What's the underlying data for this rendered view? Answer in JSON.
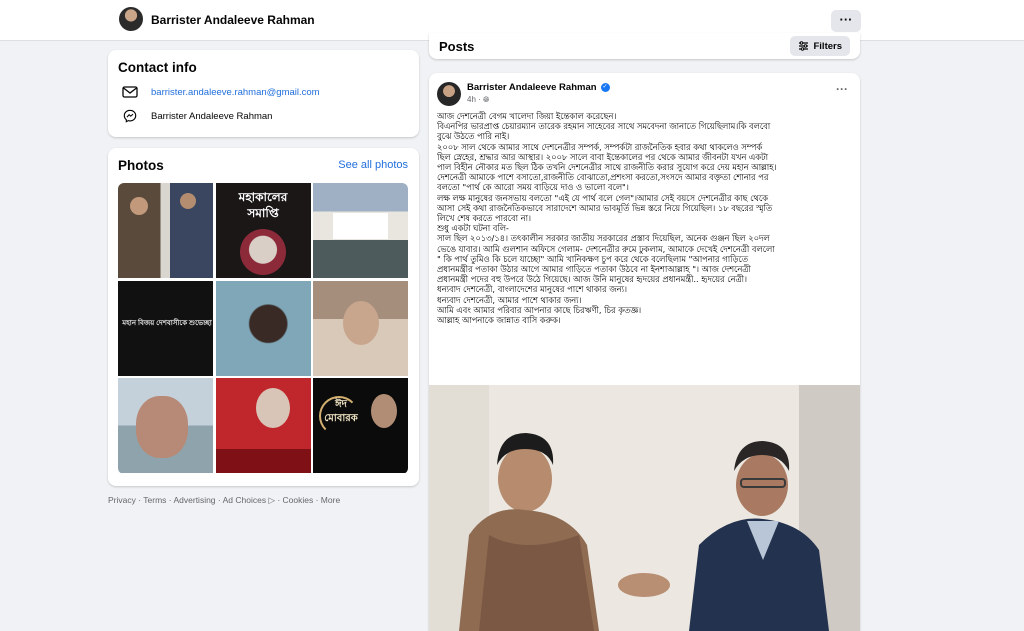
{
  "topbar": {
    "profile_name": "Barrister Andaleeve Rahman",
    "more_label": "···"
  },
  "contact": {
    "title": "Contact info",
    "email": "barrister.andaleeve.rahman@gmail.com",
    "messenger": "Barrister Andaleeve Rahman"
  },
  "photos": {
    "title": "Photos",
    "see_all": "See all photos",
    "captions": {
      "tile2": "মহাকালের সমাপ্তি",
      "tile4": "মহান বিজয় দেশবাসীকে শুভেচ্ছা",
      "tile9": "ঈদ মোবারক"
    }
  },
  "footer": {
    "links": "Privacy · Terms · Advertising · Ad Choices ▷ · Cookies · More"
  },
  "posts_header": {
    "title": "Posts",
    "filters_label": "Filters"
  },
  "post": {
    "author": "Barrister Andaleeve Rahman",
    "time": "4h · ",
    "more_label": "···",
    "lines": [
      "আজ দেশনেত্রী বেগম খালেদা জিয়া ইন্তেকাল করেছেন।",
      "বিএনপির ভারপ্রাপ্ত চেয়ারম্যান তারেক রহমান সাহেবের সাথে সমবেদনা জানাতে গিয়েছিলাম।কি বলবো",
      "বুঝে উঠতে পারি নাই।",
      "২০০৮ সাল থেকে আমার সাথে দেশনেত্রীর সম্পর্ক, সম্পর্কটা রাজনৈতিক হবার কথা থাকলেও সম্পর্ক",
      "ছিল স্নেহের, শ্রদ্ধার আর আস্থার। ২০০৮ সালে বাবা ইন্তেকালের পর থেকে আমার জীবনটা যখন একটা",
      "পাল বিহীন নৌকার মত ছিল ঠিক তখনি দেশনেত্রীর সাথে রাজনীতি করার সুযোগ করে দেয় মহান আল্লাহ।",
      "দেশনেত্রী আমাকে পাশে বসাতো,রাজনীতি বোঝাতো,প্রশংসা করতো,সংসদে আমার বক্তৃতা শোনার পর",
      "বলতো \"পার্থ কে আরো সময় বাড়িয়ে দাও ও ভালো বলে\"।",
      "লক্ষ লক্ষ মানুষের জনসভায় বলতো \"এই যে পার্থ বলে গেল\"।আমার সেই বয়সে দেশনেত্রীর কাছ থেকে",
      "আসা সেই কথা রাজনৈতিকভাবে সারাদেশে আমার ভাবমূর্তি ভিন্ন স্তরে নিয়ে গিয়েছিল। ১৮ বছরের স্মৃতি",
      "লিখে শেষ করতে পারবো না।",
      "শুধু একটা ঘটনা বলি-",
      "সাল ছিল ২০১৩/১৪। তৎকালীন সরকার জাতীয় সরকারের প্রস্তাব দিয়েছিল, অনেক গুঞ্জন ছিল ২০দল",
      "ভেঙে যাবার। আমি গুলশান অফিসে গেলাম- দেশনেত্রীর রুমে ঢুকলাম, আমাকে দেখেই দেশনেত্রী বললো",
      "\" কি পার্থ তুমিও কি চলে যাচ্ছো\" আমি খানিকক্ষণ চুপ করে থেকে বলেছিলাম \"আপনার গাড়িতে",
      "প্রধানমন্ত্রীর পতাকা উঠার আগে আমার গাড়িতে পতাকা উঠবে না ইনশাআল্লাহ \"। আজ দেশনেত্রী",
      "প্রধানমন্ত্রী পদের বহু উপরে উঠে গিয়েছে। আজ উনি মানুষের হৃদয়ের প্রধানমন্ত্রী.. হৃদয়ের নেত্রী।",
      "ধন্যবাদ দেশনেত্রী, বাংলাদেশের মানুষের পাশে থাকার জন্য।",
      "ধন্যবাদ দেশনেত্রী, আমার পাশে থাকার জন্য।",
      "আমি এবং আমার পরিবার আপনার কাছে চিরঋণী, চির কৃতজ্ঞ।",
      "আল্লাহ আপনাকে জান্নাত বাসি করুক।"
    ]
  }
}
